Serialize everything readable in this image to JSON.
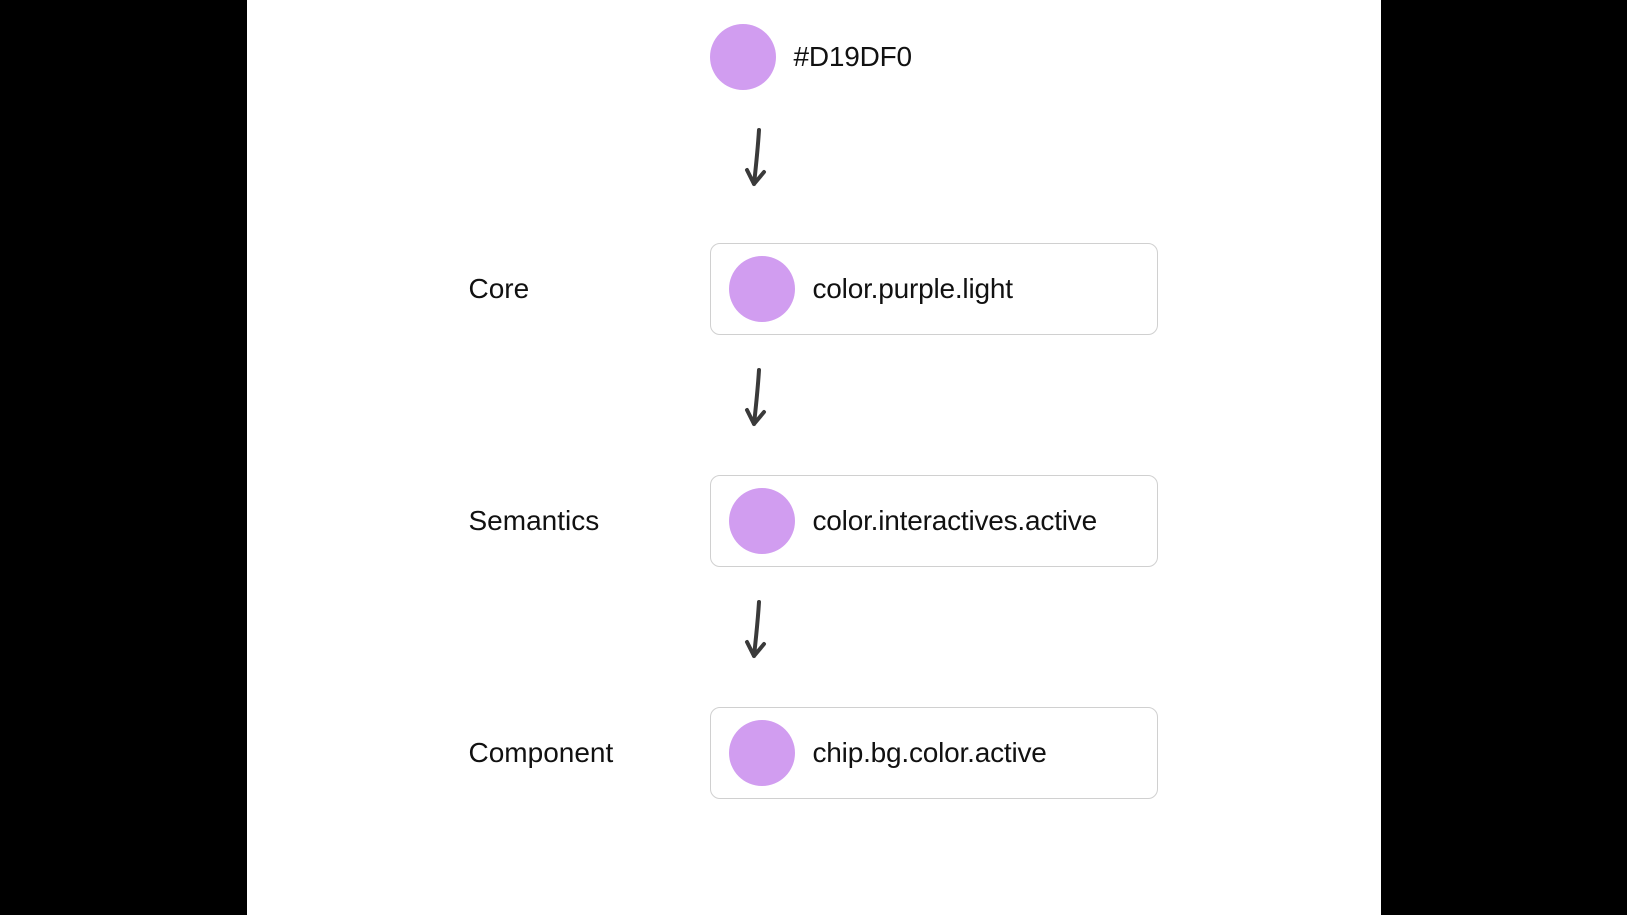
{
  "swatch_color": "#D19DF0",
  "hex": {
    "label": "#D19DF0"
  },
  "levels": [
    {
      "category": "Core",
      "token": "color.purple.light"
    },
    {
      "category": "Semantics",
      "token": "color.interactives.active"
    },
    {
      "category": "Component",
      "token": "chip.bg.color.active"
    }
  ]
}
